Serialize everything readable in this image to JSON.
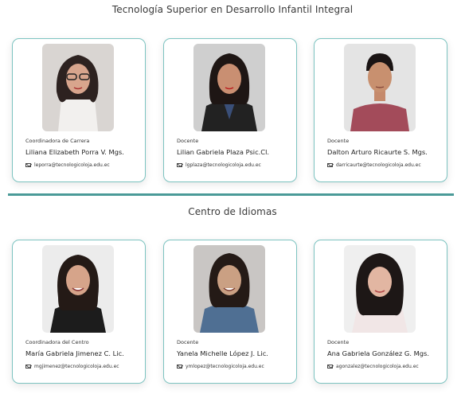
{
  "sections": [
    {
      "title": "Tecnología Superior en Desarrollo Infantil Integral",
      "cards": [
        {
          "role": "Coordinadora de Carrera",
          "name": "Liliana Elizabeth Porra V. Mgs.",
          "email": "leporra@tecnologicoloja.edu.ec"
        },
        {
          "role": "Docente",
          "name": "Lilian Gabriela Plaza Psic.Cl.",
          "email": "lgplaza@tecnologicoloja.edu.ec"
        },
        {
          "role": "Docente",
          "name": "Dalton Arturo Ricaurte S. Mgs.",
          "email": "darricaurte@tecnologicoloja.edu.ec"
        }
      ]
    },
    {
      "title": "Centro de Idiomas",
      "cards": [
        {
          "role": "Coordinadora del Centro",
          "name": "María Gabriela Jimenez C. Lic.",
          "email": "mgjimenez@tecnologicoloja.edu.ec"
        },
        {
          "role": "Docente",
          "name": "Yanela Michelle López J. Lic.",
          "email": "ymlopez@tecnologicoloja.edu.ec"
        },
        {
          "role": "Docente",
          "name": "Ana Gabriela González G. Mgs.",
          "email": "agonzalez@tecnologicoloja.edu.ec"
        }
      ]
    }
  ],
  "colors": {
    "accent": "#4a9a98",
    "card_border": "#7cc3c0"
  },
  "icons": {
    "email": "envelope-icon"
  }
}
